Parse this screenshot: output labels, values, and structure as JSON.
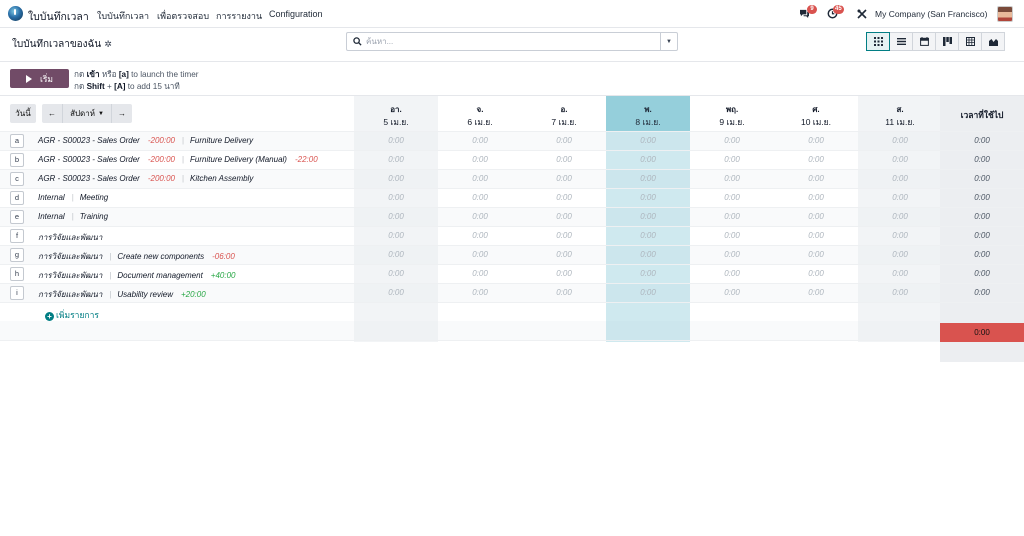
{
  "navbar": {
    "app_name": "ใบบันทึกเวลา",
    "menu": [
      "ใบบันทึกเวลา",
      "เพื่อตรวจสอบ",
      "การรายงาน",
      "Configuration"
    ],
    "messages_count": "9",
    "activities_count": "45",
    "company": "My Company (San Francisco)"
  },
  "control": {
    "title": "ใบบันทึกเวลาของฉัน",
    "search_placeholder": "ค้นหา...",
    "views": [
      "grid-icon",
      "list-icon",
      "calendar-icon",
      "kanban-icon",
      "pivot-icon",
      "graph-icon"
    ],
    "active_view": "grid-icon"
  },
  "timer": {
    "start_label": "เริ่ม",
    "hint1": {
      "pre": "กด ",
      "key1": "เข้า",
      "mid": " หรือ ",
      "key2": "[a]",
      "post": " to launch the timer"
    },
    "hint2": {
      "pre": "กด ",
      "key1": "Shift",
      "mid": " + ",
      "key2": "[A]",
      "post": " to add 15 นาที"
    }
  },
  "toolbar": {
    "today": "วันนี้",
    "scale": "สัปดาห์"
  },
  "days": [
    {
      "name": "อา.",
      "date": "5 เม.ย.",
      "type": "weekend"
    },
    {
      "name": "จ.",
      "date": "6 เม.ย.",
      "type": "normal"
    },
    {
      "name": "อ.",
      "date": "7 เม.ย.",
      "type": "normal"
    },
    {
      "name": "พ.",
      "date": "8 เม.ย.",
      "type": "today"
    },
    {
      "name": "พฤ.",
      "date": "9 เม.ย.",
      "type": "normal"
    },
    {
      "name": "ศ.",
      "date": "10 เม.ย.",
      "type": "normal"
    },
    {
      "name": "ส.",
      "date": "11 เม.ย.",
      "type": "weekend"
    }
  ],
  "total_header": "เวลาที่ใช้ไป",
  "rows": [
    {
      "key": "a",
      "project": "AGR - S00023 - Sales Order",
      "project_remaining": "-200:00",
      "task": "Furniture Delivery",
      "task_remaining": "",
      "values": [
        "0:00",
        "0:00",
        "0:00",
        "0:00",
        "0:00",
        "0:00",
        "0:00"
      ],
      "total": "0:00"
    },
    {
      "key": "b",
      "project": "AGR - S00023 - Sales Order",
      "project_remaining": "-200:00",
      "task": "Furniture Delivery (Manual)",
      "task_remaining": "-22:00",
      "values": [
        "0:00",
        "0:00",
        "0:00",
        "0:00",
        "0:00",
        "0:00",
        "0:00"
      ],
      "total": "0:00"
    },
    {
      "key": "c",
      "project": "AGR - S00023 - Sales Order",
      "project_remaining": "-200:00",
      "task": "Kitchen Assembly",
      "task_remaining": "",
      "values": [
        "0:00",
        "0:00",
        "0:00",
        "0:00",
        "0:00",
        "0:00",
        "0:00"
      ],
      "total": "0:00"
    },
    {
      "key": "d",
      "project": "Internal",
      "project_remaining": "",
      "task": "Meeting",
      "task_remaining": "",
      "values": [
        "0:00",
        "0:00",
        "0:00",
        "0:00",
        "0:00",
        "0:00",
        "0:00"
      ],
      "total": "0:00"
    },
    {
      "key": "e",
      "project": "Internal",
      "project_remaining": "",
      "task": "Training",
      "task_remaining": "",
      "values": [
        "0:00",
        "0:00",
        "0:00",
        "0:00",
        "0:00",
        "0:00",
        "0:00"
      ],
      "total": "0:00"
    },
    {
      "key": "f",
      "project": "การวิจัยและพัฒนา",
      "project_remaining": "",
      "task": "",
      "task_remaining": "",
      "values": [
        "0:00",
        "0:00",
        "0:00",
        "0:00",
        "0:00",
        "0:00",
        "0:00"
      ],
      "total": "0:00"
    },
    {
      "key": "g",
      "project": "การวิจัยและพัฒนา",
      "project_remaining": "",
      "task": "Create new components",
      "task_remaining": "-06:00",
      "values": [
        "0:00",
        "0:00",
        "0:00",
        "0:00",
        "0:00",
        "0:00",
        "0:00"
      ],
      "total": "0:00"
    },
    {
      "key": "h",
      "project": "การวิจัยและพัฒนา",
      "project_remaining": "",
      "task": "Document management",
      "task_remaining": "+40:00",
      "values": [
        "0:00",
        "0:00",
        "0:00",
        "0:00",
        "0:00",
        "0:00",
        "0:00"
      ],
      "total": "0:00"
    },
    {
      "key": "i",
      "project": "การวิจัยและพัฒนา",
      "project_remaining": "",
      "task": "Usability review",
      "task_remaining": "+20:00",
      "values": [
        "0:00",
        "0:00",
        "0:00",
        "0:00",
        "0:00",
        "0:00",
        "0:00"
      ],
      "total": "0:00"
    }
  ],
  "add_line": "เพิ่มรายการ",
  "grand_total": "0:00",
  "colors": {
    "brand": "#714b67",
    "today": "#95cfdb",
    "accent": "#017e84",
    "danger": "#d9534f"
  }
}
